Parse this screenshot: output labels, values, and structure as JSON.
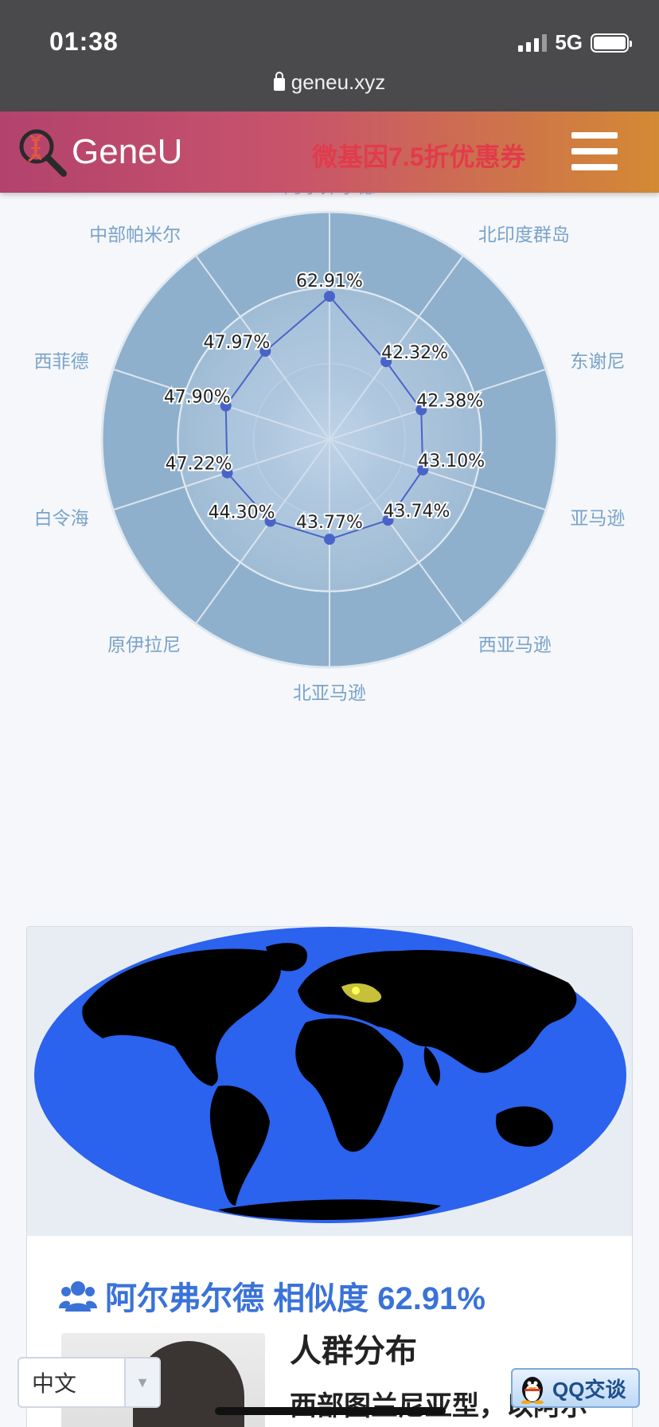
{
  "status_bar": {
    "time": "01:38",
    "network": "5G"
  },
  "browser": {
    "url": "geneu.xyz"
  },
  "header": {
    "logo_text": "GeneU",
    "promo_text": "微基因7.5折优惠券"
  },
  "chart_data": {
    "type": "radar",
    "categories": [
      "阿尔弗尔德",
      "北印度群岛",
      "东谢尼",
      "亚马逊",
      "西亚马逊",
      "北亚马逊",
      "原伊拉尼",
      "白令海",
      "西菲德",
      "中部帕米尔"
    ],
    "series": [
      {
        "values": [
          62.91,
          42.32,
          42.38,
          43.1,
          43.74,
          43.77,
          44.3,
          47.22,
          47.9,
          47.97
        ]
      }
    ],
    "value_labels": [
      "62.91%",
      "42.32%",
      "42.38%",
      "43.10%",
      "43.74%",
      "43.77%",
      "44.30%",
      "47.22%",
      "47.90%",
      "47.97%"
    ],
    "range": [
      0,
      100
    ],
    "rings": 3,
    "series_color": "#4a63c8"
  },
  "map_card": {
    "heading": "阿尔弗尔德 相似度 62.91%",
    "distribution_title": "人群分布",
    "distribution_text": "西部图兰尼亚型，以阿尔"
  },
  "footer": {
    "language": "中文",
    "qq_label": "QQ交谈"
  },
  "colors": {
    "accent": "#3a72d8",
    "map_ocean": "#2b62ee",
    "map_land": "#000000",
    "map_highlight": "#c7c03a"
  }
}
